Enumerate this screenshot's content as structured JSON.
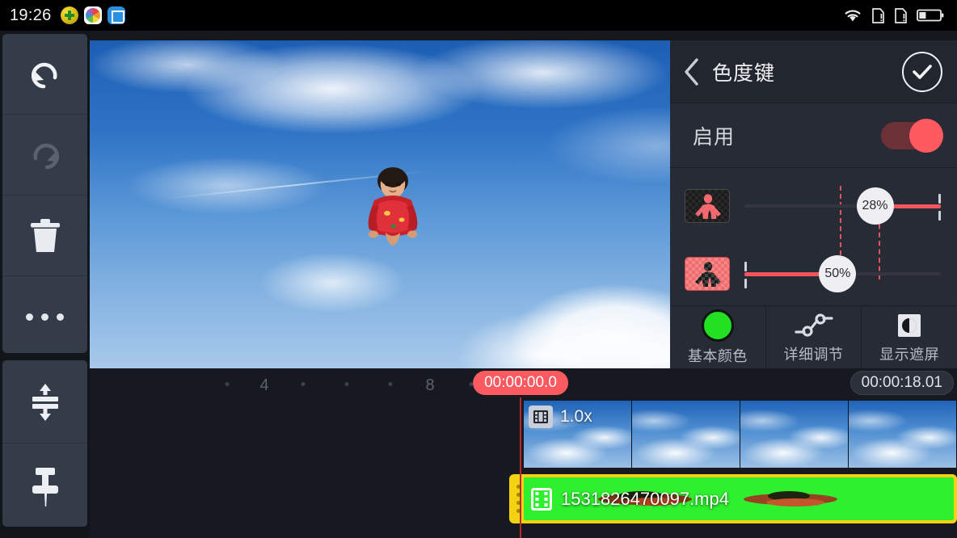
{
  "statusbar": {
    "clock": "19:26",
    "notification_icons": [
      "green-plus-app-icon",
      "rainbow-color-app-icon",
      "blue-scan-app-icon"
    ],
    "system_icons": [
      "wifi-icon",
      "sim-missing-icon",
      "sim-missing-icon-2",
      "battery-icon"
    ]
  },
  "toolrail": {
    "items": [
      {
        "name": "undo-button",
        "icon": "undo-icon",
        "enabled": true
      },
      {
        "name": "redo-button",
        "icon": "redo-icon",
        "enabled": false
      },
      {
        "name": "delete-button",
        "icon": "trash-icon",
        "enabled": true
      },
      {
        "name": "more-button",
        "icon": "more-dots-icon",
        "enabled": true
      },
      {
        "name": "expand-tracks-button",
        "icon": "expand-vertical-icon",
        "enabled": true
      },
      {
        "name": "pin-button",
        "icon": "pin-icon",
        "enabled": true
      }
    ]
  },
  "preview": {
    "label": "video-preview"
  },
  "panel": {
    "title": "色度键",
    "back_icon": "chevron-left-icon",
    "apply_icon": "check-icon",
    "enable_label": "启用",
    "enable_on": true,
    "sliders": [
      {
        "name": "key-level-slider",
        "value": "28%",
        "percent": 28,
        "swatch": "dark-figure-red-thumbnail"
      },
      {
        "name": "blend-slider",
        "value": "50%",
        "percent": 50,
        "swatch": "red-figure-dark-thumbnail"
      }
    ],
    "tabs": [
      {
        "label": "基本颜色",
        "icon": "green-color-circle-icon",
        "active": true
      },
      {
        "label": "详细调节",
        "icon": "curve-nodes-icon",
        "active": false
      },
      {
        "label": "显示遮屏",
        "icon": "contrast-square-icon",
        "active": false
      }
    ]
  },
  "timeline": {
    "playhead_time": "00:00:00.0",
    "total_duration": "00:00:18.01",
    "ruler_marks": [
      "4",
      "8"
    ],
    "tracks": [
      {
        "name": "background-video-track",
        "speed_label": "1.0x",
        "icon": "film-strip-icon",
        "thumbnails": [
          "sky-frame-1",
          "sky-frame-2",
          "sky-frame-3",
          "sky-frame-4"
        ]
      },
      {
        "name": "overlay-video-track",
        "filename": "1531826470097.mp4",
        "icon": "film-strip-icon",
        "selected": true
      }
    ]
  },
  "colors": {
    "accent_red": "#fa5a60",
    "chroma_green": "#2ef02e",
    "selection_yellow": "#f5d211",
    "panel_bg": "#272b36",
    "app_bg": "#16191f"
  }
}
